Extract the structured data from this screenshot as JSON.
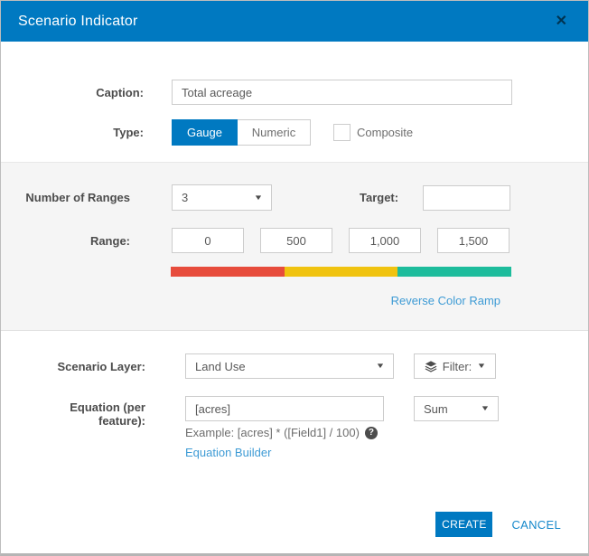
{
  "title_bar": {
    "title": "Scenario Indicator"
  },
  "icons": {
    "close": "✕",
    "caret_down": "▼",
    "help": "?"
  },
  "form": {
    "caption": {
      "label": "Caption:",
      "value": "Total acreage"
    },
    "type": {
      "label": "Type:",
      "options": [
        {
          "label": "Gauge",
          "selected": true
        },
        {
          "label": "Numeric",
          "selected": false
        }
      ],
      "composite": {
        "label": "Composite",
        "checked": false
      }
    },
    "ranges_section": {
      "number_of_ranges": {
        "label": "Number of Ranges",
        "value": "3"
      },
      "target": {
        "label": "Target:",
        "value": ""
      },
      "range": {
        "label": "Range:",
        "values": [
          "0",
          "500",
          "1,000",
          "1,500"
        ]
      },
      "color_ramp": {
        "colors": [
          "#e74c3c",
          "#f0c30f",
          "#1dbc9c"
        ]
      },
      "reverse_link": "Reverse Color Ramp"
    },
    "scenario_layer": {
      "label": "Scenario Layer:",
      "value": "Land Use",
      "filter": {
        "label": "Filter:"
      }
    },
    "equation": {
      "label_lines": [
        "Equation (per",
        "feature):"
      ],
      "value": "[acres]",
      "example": "Example: [acres] * ([Field1] / 100)",
      "builder_link": "Equation Builder",
      "aggregation": {
        "value": "Sum"
      }
    }
  },
  "footer": {
    "create_label": "CREATE",
    "cancel_label": "CANCEL"
  },
  "colors": {
    "header_bg": "#0079c1",
    "accent": "#0079c1",
    "link": "#3e9bd5",
    "ramp_red": "#e74c3c",
    "ramp_yellow": "#f0c30f",
    "ramp_green": "#1dbc9c"
  }
}
